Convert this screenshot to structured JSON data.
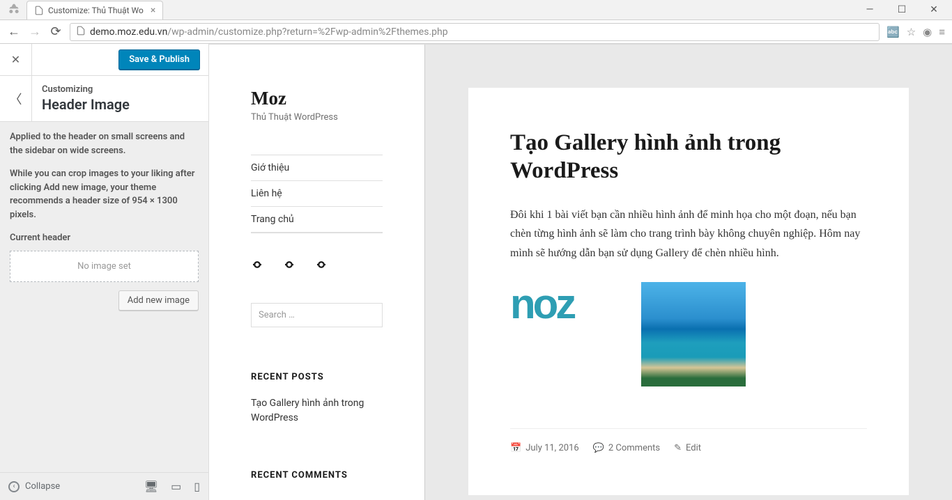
{
  "browser": {
    "tab_title": "Customize: Thủ Thuật Wo",
    "url_host": "demo.moz.edu.vn",
    "url_path": "/wp-admin/customize.php?return=%2Fwp-admin%2Fthemes.php"
  },
  "customizer": {
    "save_label": "Save & Publish",
    "customizing_label": "Customizing",
    "section_title": "Header Image",
    "desc1": "Applied to the header on small screens and the sidebar on wide screens.",
    "desc2": "While you can crop images to your liking after clicking Add new image, your theme recommends a header size of 954 × 1300 pixels.",
    "current_header_label": "Current header",
    "no_image_text": "No image set",
    "add_image_label": "Add new image",
    "collapse_label": "Collapse"
  },
  "site": {
    "title": "Moz",
    "tagline": "Thủ Thuật WordPress",
    "nav": {
      "item0": "Giớ thiệu",
      "item1": "Liên hệ",
      "item2": "Trang chủ"
    },
    "search_placeholder": "Search …",
    "recent_posts_heading": "RECENT POSTS",
    "recent_post_0": "Tạo Gallery hình ảnh trong WordPress",
    "recent_comments_heading": "RECENT COMMENTS"
  },
  "post": {
    "title": "Tạo Gallery hình ảnh trong WordPress",
    "body": "Đôi khi 1 bài viết bạn cần nhiều hình ảnh để minh họa cho một đoạn, nếu bạn chèn từng hình ảnh sẽ làm cho trang trình bày không chuyên nghiệp. Hôm nay mình sẽ hướng dẫn bạn sử dụng Gallery để chèn nhiều hình.",
    "logo_text": "noz",
    "date": "July 11, 2016",
    "comments": "2 Comments",
    "edit": "Edit"
  }
}
